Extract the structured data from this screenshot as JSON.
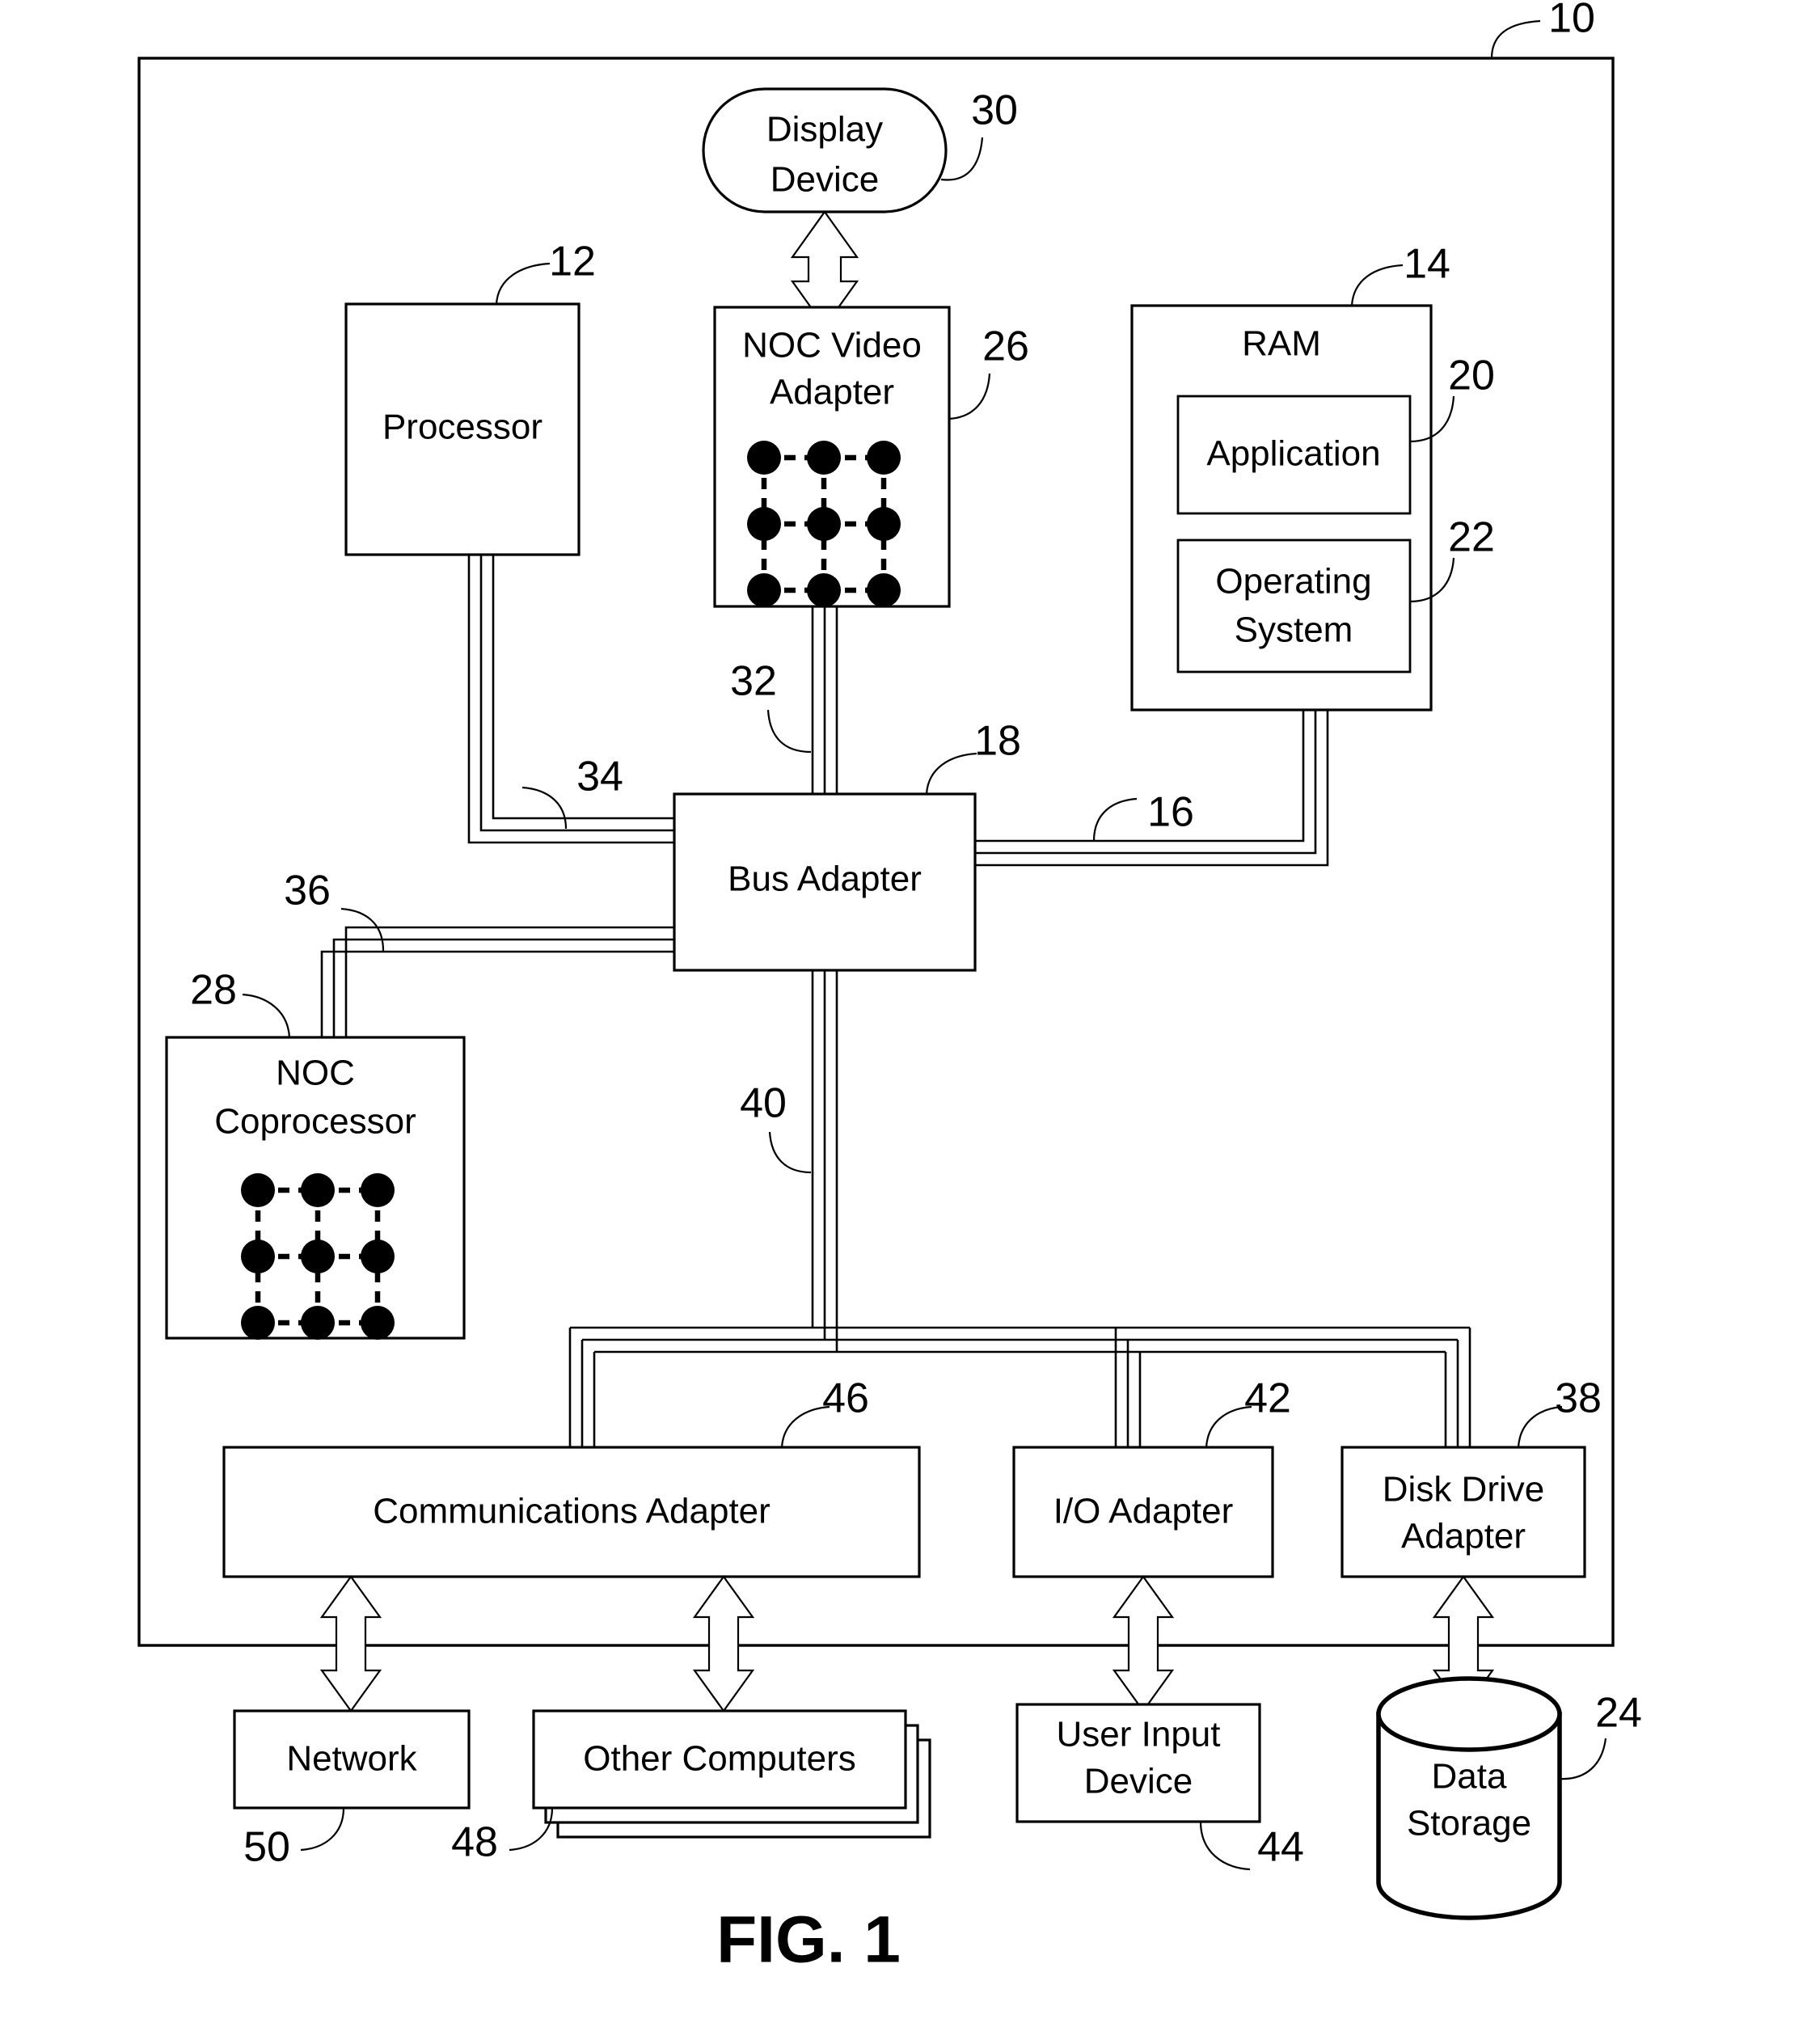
{
  "figure": {
    "caption": "FIG. 1",
    "outer_frame_ref": "10"
  },
  "blocks": {
    "display_device": {
      "label_line1": "Display",
      "label_line2": "Device",
      "ref": "30",
      "shape": "stadium"
    },
    "processor": {
      "label": "Processor",
      "ref": "12",
      "shape": "rect"
    },
    "noc_video_adapter": {
      "label_line1": "NOC Video",
      "label_line2": "Adapter",
      "ref": "26",
      "shape": "rect",
      "mesh": "3x3"
    },
    "ram": {
      "label": "RAM",
      "ref": "14",
      "shape": "rect"
    },
    "application": {
      "label": "Application",
      "ref": "20",
      "shape": "rect"
    },
    "operating_system": {
      "label_line1": "Operating",
      "label_line2": "System",
      "ref": "22",
      "shape": "rect"
    },
    "bus_adapter": {
      "label": "Bus Adapter",
      "ref": "18",
      "shape": "rect"
    },
    "noc_coprocessor": {
      "label_line1": "NOC",
      "label_line2": "Coprocessor",
      "ref": "28",
      "shape": "rect",
      "mesh": "3x3"
    },
    "communications_adapter": {
      "label": "Communications Adapter",
      "ref": "46",
      "shape": "rect"
    },
    "io_adapter": {
      "label": "I/O Adapter",
      "ref": "42",
      "shape": "rect"
    },
    "disk_drive_adapter": {
      "label_line1": "Disk Drive",
      "label_line2": "Adapter",
      "ref": "38",
      "shape": "rect"
    },
    "network": {
      "label": "Network",
      "ref": "50",
      "shape": "rect"
    },
    "other_computers": {
      "label": "Other Computers",
      "ref": "48",
      "shape": "stacked-rect"
    },
    "user_input_device": {
      "label_line1": "User Input",
      "label_line2": "Device",
      "ref": "44",
      "shape": "rect"
    },
    "data_storage": {
      "label_line1": "Data",
      "label_line2": "Storage",
      "ref": "24",
      "shape": "cylinder"
    }
  },
  "buses": {
    "video_bus": {
      "ref": "32",
      "from": "noc_video_adapter",
      "to": "bus_adapter"
    },
    "front_side_bus": {
      "ref": "34",
      "from": "processor",
      "to": "bus_adapter"
    },
    "memory_bus": {
      "ref": "16",
      "from": "bus_adapter",
      "to": "ram"
    },
    "coprocessor_bus": {
      "ref": "36",
      "from": "bus_adapter",
      "to": "noc_coprocessor"
    },
    "expansion_bus": {
      "ref": "40",
      "from": "bus_adapter",
      "to": "adapter_row"
    }
  },
  "reference_numerals": [
    "10",
    "12",
    "14",
    "16",
    "18",
    "20",
    "22",
    "24",
    "26",
    "28",
    "30",
    "32",
    "34",
    "36",
    "38",
    "40",
    "42",
    "44",
    "46",
    "48",
    "50"
  ],
  "colors": {
    "stroke": "#000000",
    "background": "#ffffff"
  }
}
